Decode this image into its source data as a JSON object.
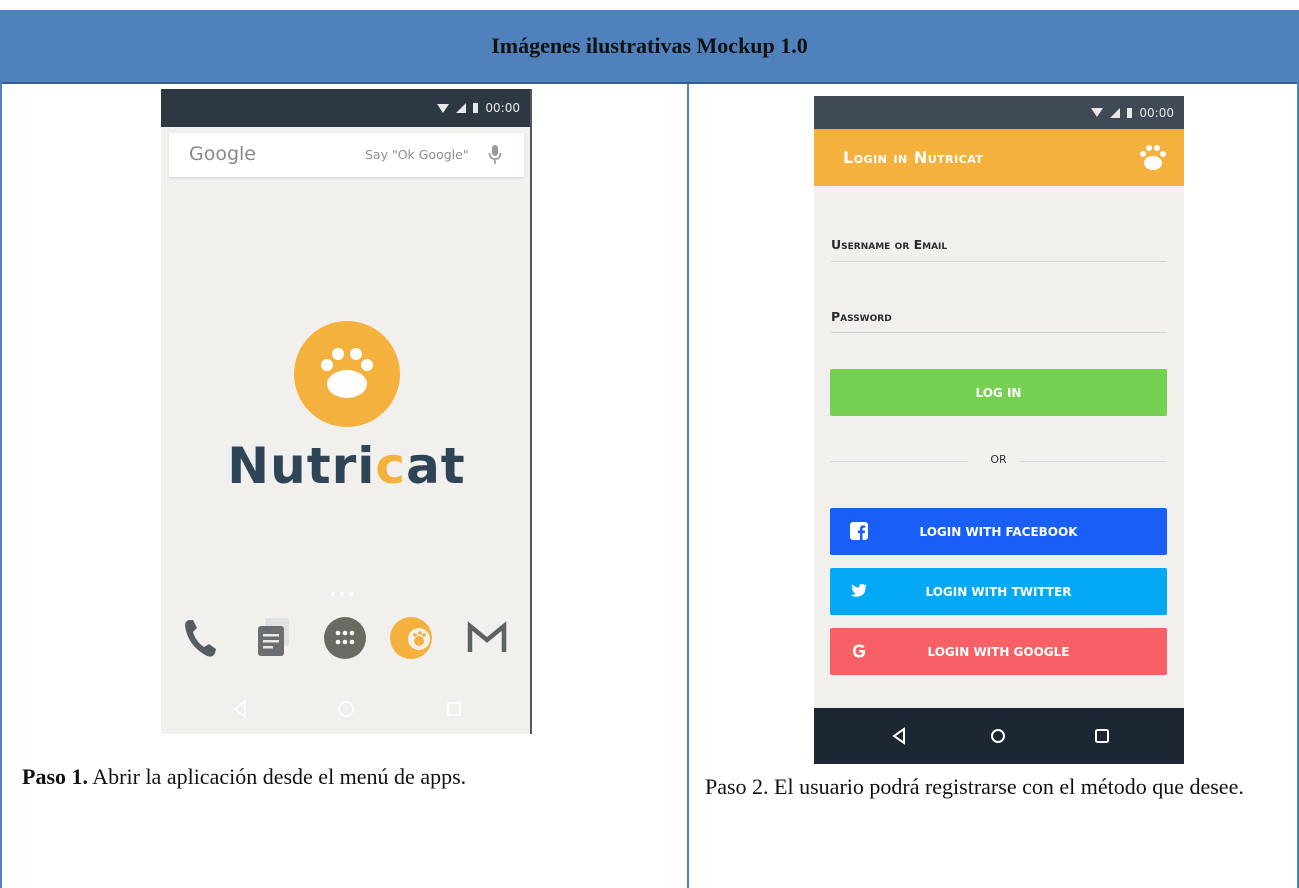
{
  "header": {
    "title": "Imágenes ilustrativas Mockup 1.0"
  },
  "left": {
    "status_time": "00:00",
    "google": {
      "logo": "Google",
      "hint": "Say \"Ok Google\""
    },
    "brand": {
      "before": "Nutri",
      "accent": "c",
      "after": "at"
    },
    "dock_icons": [
      "phone-icon",
      "messages-icon",
      "apps-grid-icon",
      "nutricat-app-icon",
      "gmail-icon"
    ],
    "nav_icons": [
      "back-icon",
      "home-icon",
      "recents-icon"
    ],
    "caption": {
      "bold": "Paso 1.",
      "text": " Abrir la aplicación desde el menú de apps."
    }
  },
  "right": {
    "status_time": "00:00",
    "title": "Login in Nutricat",
    "username_label": "Username or Email",
    "password_label": "Password",
    "login_button": "LOG IN",
    "or_text": "OR",
    "social_buttons": [
      {
        "label": "LOGIN WITH FACEBOOK",
        "icon": "facebook-icon",
        "color": "#1a5ff5"
      },
      {
        "label": "LOGIN WITH TWITTER",
        "icon": "twitter-icon",
        "color": "#03a9f4"
      },
      {
        "label": "LOGIN WITH GOOGLE",
        "icon": "google-g-icon",
        "color": "#f76065"
      }
    ],
    "nav_icons": [
      "back-icon",
      "home-icon",
      "recents-icon"
    ],
    "caption": "Paso 2. El usuario podrá registrarse con el método que desee."
  },
  "colors": {
    "header_blue": "#4f81bd",
    "accent_orange": "#f4b13e",
    "login_green": "#76d152",
    "navy": "#2f4457"
  }
}
